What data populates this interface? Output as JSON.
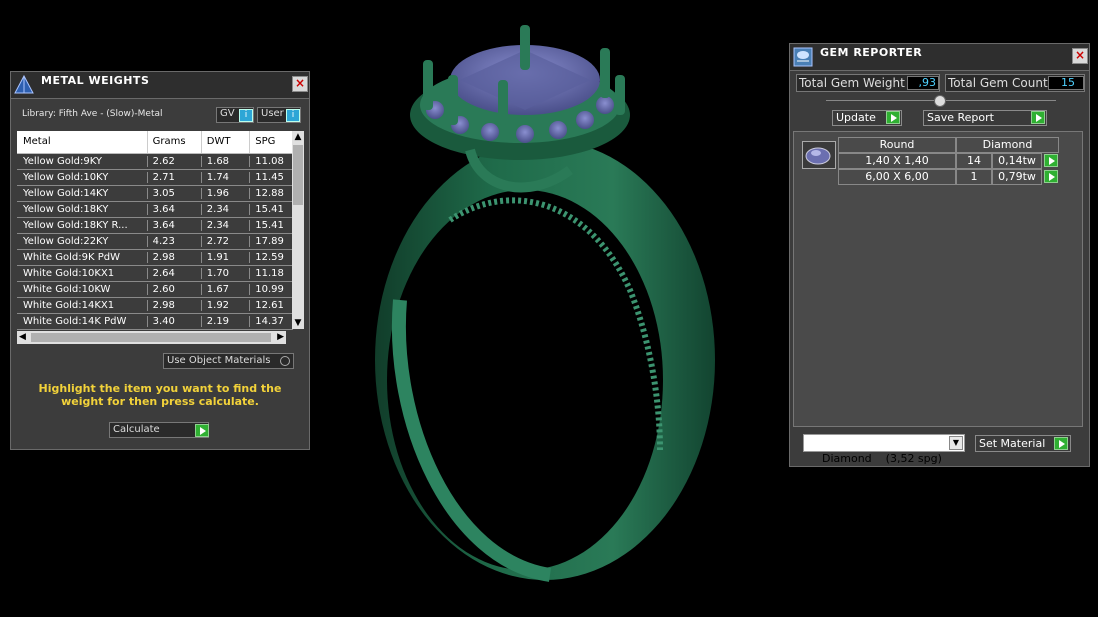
{
  "metal_weights": {
    "title": "METAL WEIGHTS",
    "library": "Library: Fifth Ave - (Slow)-Metal",
    "gv_label": "GV",
    "user_label": "User",
    "columns": [
      "Metal",
      "Grams",
      "DWT",
      "SPG"
    ],
    "rows": [
      [
        "Yellow Gold:9KY",
        "2.62",
        "1.68",
        "11.08"
      ],
      [
        "Yellow Gold:10KY",
        "2.71",
        "1.74",
        "11.45"
      ],
      [
        "Yellow Gold:14KY",
        "3.05",
        "1.96",
        "12.88"
      ],
      [
        "Yellow Gold:18KY",
        "3.64",
        "2.34",
        "15.41"
      ],
      [
        "Yellow Gold:18KY R...",
        "3.64",
        "2.34",
        "15.41"
      ],
      [
        "Yellow Gold:22KY",
        "4.23",
        "2.72",
        "17.89"
      ],
      [
        "White Gold:9K PdW",
        "2.98",
        "1.91",
        "12.59"
      ],
      [
        "White Gold:10KX1",
        "2.64",
        "1.70",
        "11.18"
      ],
      [
        "White Gold:10KW",
        "2.60",
        "1.67",
        "10.99"
      ],
      [
        "White Gold:14KX1",
        "2.98",
        "1.92",
        "12.61"
      ],
      [
        "White Gold:14K PdW",
        "3.40",
        "2.19",
        "14.37"
      ]
    ],
    "use_object_materials": "Use Object Materials",
    "instruction": "Highlight the item you want to find the weight for then press calculate.",
    "calculate_label": "Calculate"
  },
  "gem_reporter": {
    "title": "GEM REPORTER",
    "total_weight_label": "Total Gem Weight",
    "total_weight_value": ",93",
    "total_count_label": "Total Gem Count",
    "total_count_value": "15",
    "update_label": "Update",
    "save_report_label": "Save Report",
    "shape_header": "Round",
    "material_header": "Diamond",
    "gems": [
      {
        "size": "1,40 X 1,40",
        "count": "14",
        "weight": "0,14tw"
      },
      {
        "size": "6,00 X 6,00",
        "count": "1",
        "weight": "0,79tw"
      }
    ],
    "material_select": "Diamond    (3,52 spg)",
    "set_material_label": "Set Material"
  },
  "colors": {
    "ring": "#1f6b4a",
    "gem": "#6b6fb0",
    "accent_green": "#2fb032",
    "instruction_text": "#f2d23a"
  }
}
